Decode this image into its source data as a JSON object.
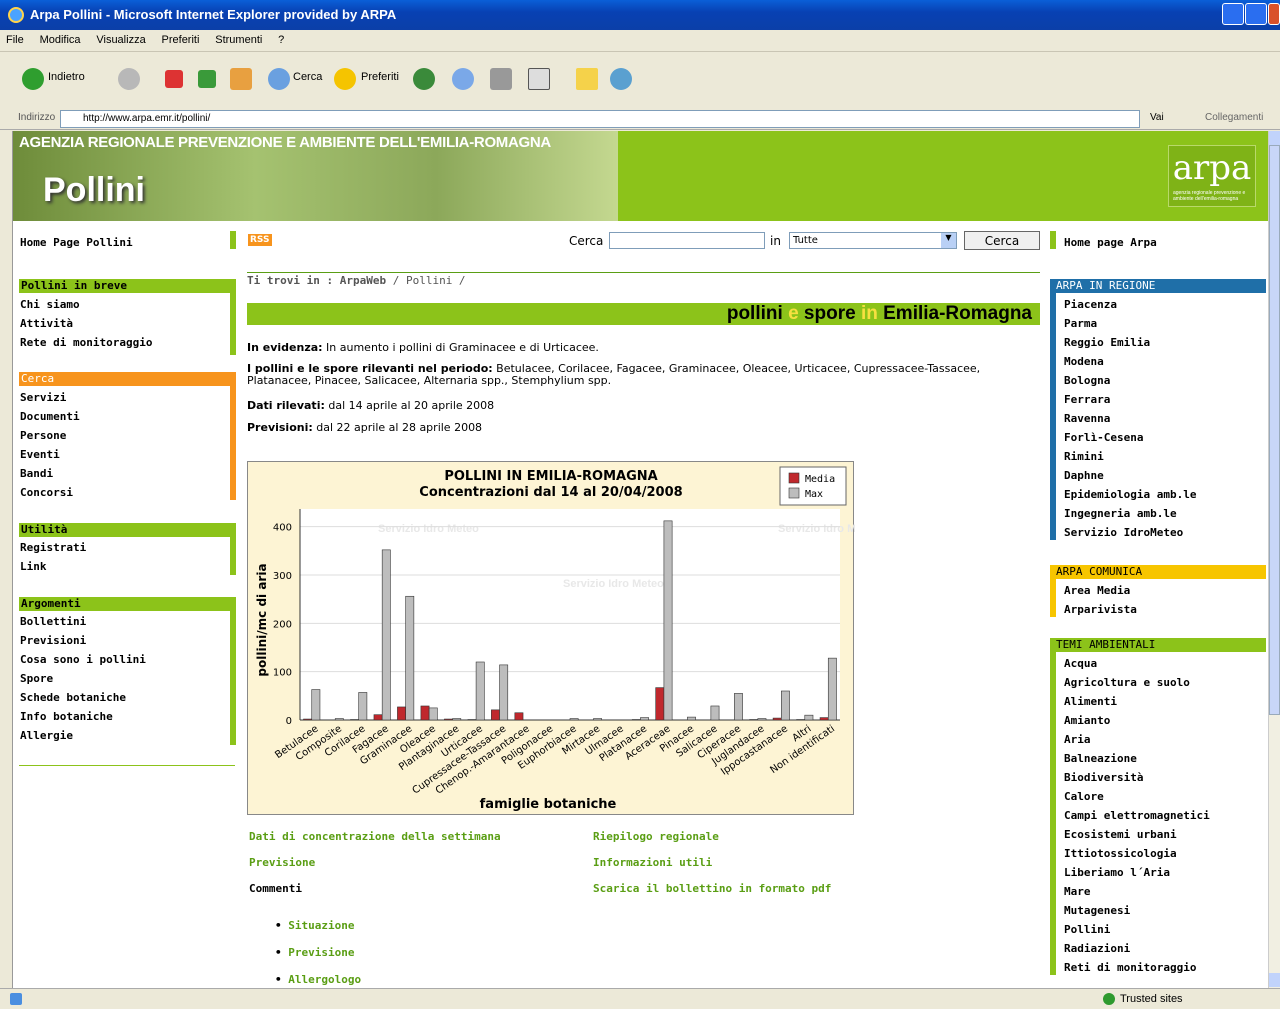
{
  "window": {
    "title": "Arpa Pollini - Microsoft Internet Explorer provided by ARPA"
  },
  "menubar": [
    "File",
    "Modifica",
    "Visualizza",
    "Preferiti",
    "Strumenti",
    "?"
  ],
  "toolbar": {
    "back": "Indietro",
    "search": "Cerca",
    "favorites": "Preferiti"
  },
  "address": {
    "label": "Indirizzo",
    "url": "http://www.arpa.emr.it/pollini/",
    "go": "Vai",
    "links": "Collegamenti"
  },
  "banner": {
    "agency": "AGENZIA REGIONALE PREVENZIONE E AMBIENTE DELL'EMILIA-ROMAGNA",
    "title": "Pollini",
    "logo": "arpa",
    "logo_sub": "agenzia regionale prevenzione e ambiente dell'emilia-romagna"
  },
  "topbar": {
    "home_pollini": "Home Page Pollini",
    "rss": "RSS",
    "search_label": "Cerca",
    "in_label": "in",
    "select_value": "Tutte",
    "search_button": "Cerca",
    "home_arpa": "Home page Arpa"
  },
  "left": {
    "sections": [
      {
        "header": "Pollini in breve",
        "items": [
          "Chi siamo",
          "Attività",
          "Rete di monitoraggio"
        ]
      },
      {
        "header": "Cerca",
        "items": [
          "Servizi",
          "Documenti",
          "Persone",
          "Eventi",
          "Bandi",
          "Concorsi"
        ]
      },
      {
        "header": "Utilità",
        "items": [
          "Registrati",
          "Link"
        ]
      },
      {
        "header": "Argomenti",
        "items": [
          "Bollettini",
          "Previsioni",
          "Cosa sono i pollini",
          "Spore",
          "Schede botaniche",
          "Info botaniche",
          "Allergie"
        ]
      }
    ]
  },
  "right": {
    "sections": [
      {
        "header": "ARPA IN REGIONE",
        "items": [
          "Piacenza",
          "Parma",
          "Reggio Emilia",
          "Modena",
          "Bologna",
          "Ferrara",
          "Ravenna",
          "Forlì-Cesena",
          "Rimini",
          "Daphne",
          "Epidemiologia amb.le",
          "Ingegneria amb.le",
          "Servizio IdroMeteo"
        ]
      },
      {
        "header": "ARPA COMUNICA",
        "items": [
          "Area Media",
          "Arparivista"
        ]
      },
      {
        "header": "TEMI AMBIENTALI",
        "items": [
          "Acqua",
          "Agricoltura e suolo",
          "Alimenti",
          "Amianto",
          "Aria",
          "Balneazione",
          "Biodiversità",
          "Calore",
          "Campi elettromagnetici",
          "Ecosistemi urbani",
          "Ittiotossicologia",
          "Liberiamo l´Aria",
          "Mare",
          "Mutagenesi",
          "Pollini",
          "Radiazioni",
          "Reti di monitoraggio"
        ]
      }
    ]
  },
  "main": {
    "breadcrumb_prefix": "Ti trovi in :",
    "breadcrumb_1": "ArpaWeb",
    "breadcrumb_sep": "/",
    "breadcrumb_2": "Pollini /",
    "heading_a": "pollini",
    "heading_b": "e",
    "heading_c": "spore",
    "heading_d": "in",
    "heading_e": "Emilia-Romagna",
    "evidenza_label": "In evidenza:",
    "evidenza_text": "In aumento i pollini di Graminacee e di Urticacee.",
    "rilevanti_label": "I pollini e le spore rilevanti nel periodo:",
    "rilevanti_text": "Betulacee, Corilacee, Fagacee, Graminacee, Oleacee, Urticacee, Cupressacee-Tassacee, Platanacee, Pinacee, Salicacee, Alternaria spp., Stemphylium spp.",
    "dati_label": "Dati rilevati:",
    "dati_text": "dal 14 aprile al 20 aprile 2008",
    "prev_label": "Previsioni:",
    "prev_text": "dal 22 aprile al 28 aprile 2008",
    "links_left": [
      "Dati di concentrazione della settimana",
      "Previsione"
    ],
    "commenti": "Commenti",
    "links_right": [
      "Riepilogo regionale",
      "Informazioni utili",
      "Scarica il bollettino in formato pdf"
    ],
    "bullets": [
      "Situazione",
      "Previsione",
      "Allergologo"
    ]
  },
  "status": {
    "zone": "Trusted sites"
  },
  "colors": {
    "green": "#8cc31a",
    "orange": "#f7941d",
    "blue": "#1f6fa8",
    "yellow": "#f7c500",
    "media": "#c0282d",
    "max": "#bdbdbd"
  },
  "chart_data": {
    "type": "bar",
    "title": "POLLINI IN EMILIA-ROMAGNA",
    "subtitle": "Concentrazioni dal 14 al 20/04/2008",
    "xlabel": "famiglie botaniche",
    "ylabel": "pollini/mc di aria",
    "ylim": [
      0,
      420
    ],
    "yticks": [
      0,
      100,
      200,
      300,
      400
    ],
    "legend_position": "top-right",
    "watermark": "Servizio Idro Meteo",
    "categories": [
      "Betulacee",
      "Composite",
      "Corilacee",
      "Fagacee",
      "Graminacee",
      "Oleacee",
      "Plantaginacee",
      "Urticacee",
      "Cupressacee-Tassacee",
      "Chenop.-Amarantacee",
      "Poligonacee",
      "Euphorbiacee",
      "Mirtacee",
      "Ulmacee",
      "Platanacee",
      "Aceraceae",
      "Pinacee",
      "Salicacee",
      "Ciperacee",
      "Juglandacee",
      "Ippocastanacee",
      "Altri",
      "Non identificati"
    ],
    "series": [
      {
        "name": "Media",
        "values": [
          2,
          0,
          1,
          11,
          27,
          29,
          2,
          1,
          21,
          15,
          0,
          0,
          0,
          0,
          1,
          67,
          0,
          0,
          0,
          1,
          4,
          1,
          5
        ]
      },
      {
        "name": "Max",
        "values": [
          63,
          3,
          57,
          352,
          256,
          25,
          3,
          120,
          114,
          0,
          0,
          3,
          3,
          0,
          5,
          412,
          6,
          29,
          55,
          3,
          60,
          10,
          128
        ]
      }
    ]
  }
}
